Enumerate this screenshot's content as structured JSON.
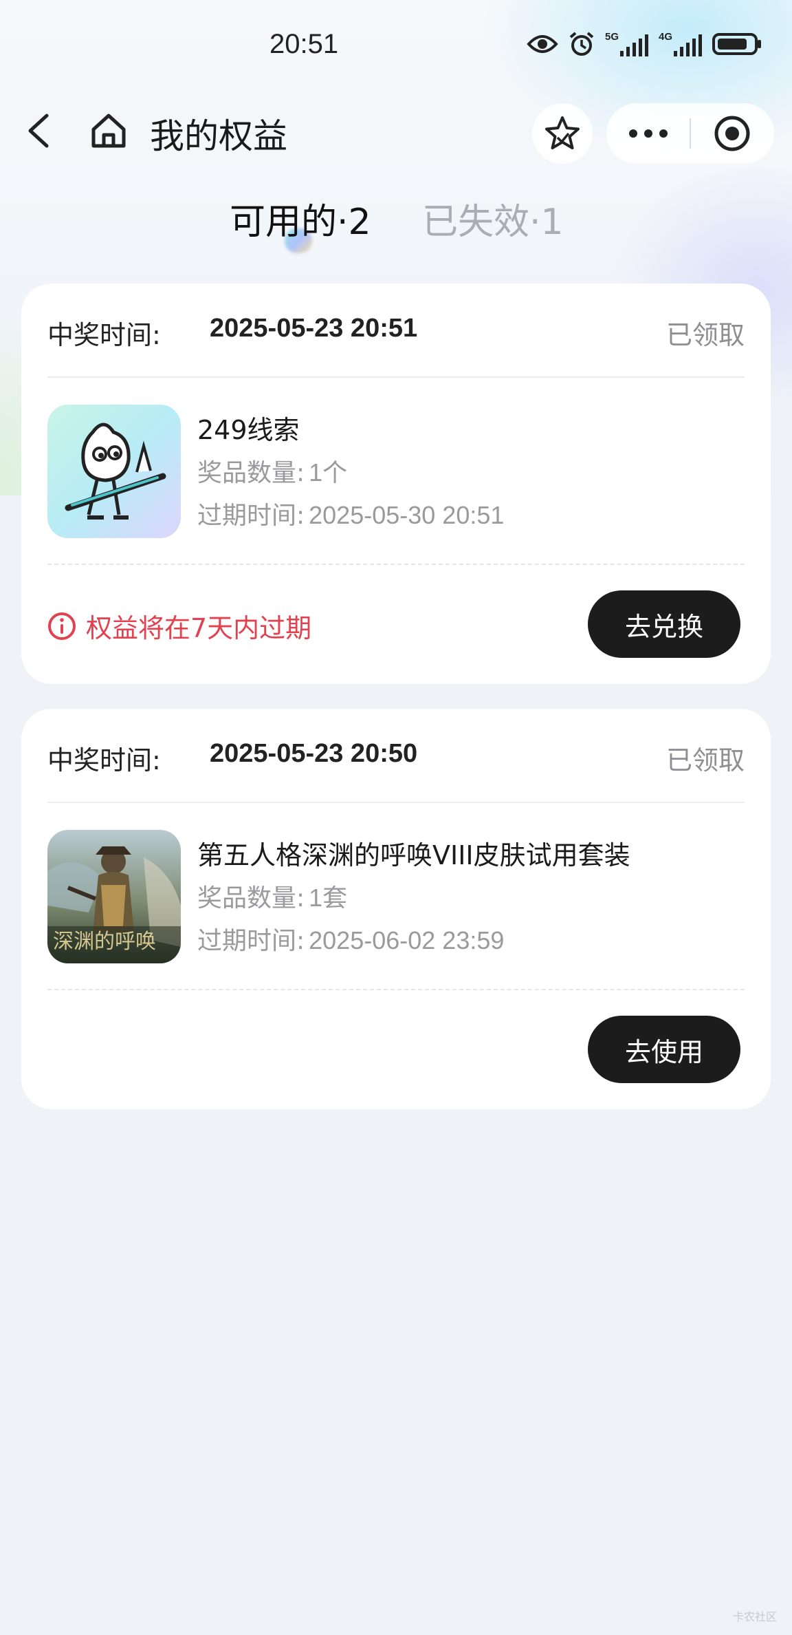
{
  "status_bar": {
    "time": "20:51",
    "icons": [
      "eye-icon",
      "alarm-icon",
      "signal-5g-icon",
      "signal-4g-icon",
      "battery-icon"
    ],
    "net1": "5G",
    "net2": "4G"
  },
  "nav": {
    "title": "我的权益",
    "icons": [
      "back-arrow-icon",
      "home-icon",
      "star-icon",
      "more-icon",
      "target-close-icon"
    ]
  },
  "tabs": [
    {
      "label": "可用的·2",
      "active": true
    },
    {
      "label": "已失效·1",
      "active": false
    }
  ],
  "cards": [
    {
      "win_label": "中奖时间:",
      "win_time": "2025-05-23 20:51",
      "status": "已领取",
      "prize_name": "249线索",
      "qty_label": "奖品数量:",
      "qty_value": "1个",
      "exp_label": "过期时间:",
      "exp_value": "2025-05-30 20:51",
      "warning": "权益将在7天内过期",
      "button": "去兑换",
      "image": "mascot-guitar-image"
    },
    {
      "win_label": "中奖时间:",
      "win_time": "2025-05-23 20:50",
      "status": "已领取",
      "prize_name": "第五人格深渊的呼唤VIII皮肤试用套装",
      "qty_label": "奖品数量:",
      "qty_value": "1套",
      "exp_label": "过期时间:",
      "exp_value": "2025-06-02 23:59",
      "button": "去使用",
      "image": "game-poster-image"
    }
  ],
  "colors": {
    "warning": "#e0424f",
    "button_bg": "#1c1c1c",
    "page_bg": "#eff2f7"
  }
}
